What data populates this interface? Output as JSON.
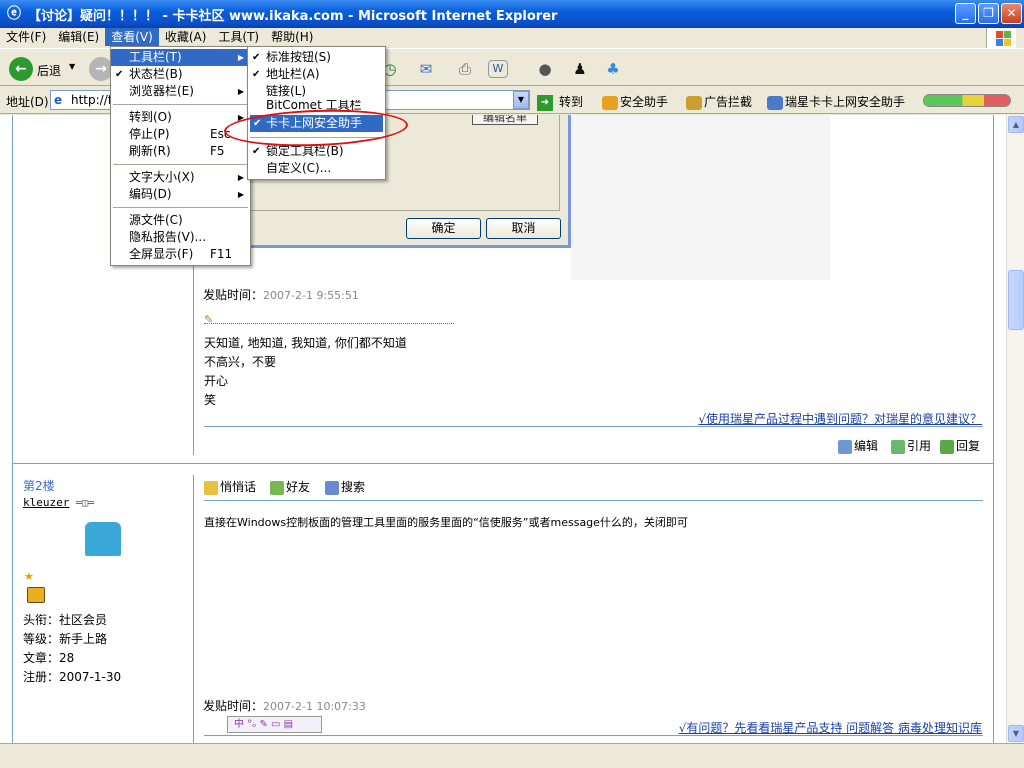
{
  "window": {
    "title": "【讨论】疑问！！！！ - 卡卡社区 www.ikaka.com - Microsoft Internet Explorer",
    "min": "_",
    "max": "❐",
    "close": "✕"
  },
  "menubar": [
    "文件(F)",
    "编辑(E)",
    "查看(V)",
    "收藏(A)",
    "工具(T)",
    "帮助(H)"
  ],
  "toolbar": {
    "back_label": "后退"
  },
  "address": {
    "label": "地址(D)",
    "value": "http://fo",
    "go": "转到",
    "tools": [
      "安全助手",
      "广告拦截",
      "瑞星卡卡上网安全助手"
    ]
  },
  "view_menu": {
    "items": [
      {
        "label": "工具栏(T)",
        "submenu": true,
        "highlight": true
      },
      {
        "label": "状态栏(B)",
        "checked": true
      },
      {
        "label": "浏览器栏(E)",
        "submenu": true
      },
      {
        "sep": true
      },
      {
        "label": "转到(O)",
        "submenu": true
      },
      {
        "label": "停止(P)",
        "shortcut": "Esc"
      },
      {
        "label": "刷新(R)",
        "shortcut": "F5"
      },
      {
        "sep": true
      },
      {
        "label": "文字大小(X)",
        "submenu": true
      },
      {
        "label": "编码(D)",
        "submenu": true
      },
      {
        "sep": true
      },
      {
        "label": "源文件(C)"
      },
      {
        "label": "隐私报告(V)..."
      },
      {
        "label": "全屏显示(F)",
        "shortcut": "F11"
      }
    ]
  },
  "toolbar_menu": {
    "items": [
      {
        "label": "标准按钮(S)",
        "checked": true
      },
      {
        "label": "地址栏(A)",
        "checked": true
      },
      {
        "label": "链接(L)"
      },
      {
        "label": "BitComet 工具栏"
      },
      {
        "label": "卡卡上网安全助手",
        "checked": true,
        "highlight": true
      },
      {
        "label": "锁定工具栏(B)",
        "checked": true
      },
      {
        "label": "自定义(C)..."
      }
    ]
  },
  "dialog": {
    "edit": "编辑名单",
    "ok": "确定",
    "cancel": "取消"
  },
  "post1": {
    "time_label": "发贴时间：",
    "time": "2007-2-1 9:55:51",
    "lines": [
      "天知道, 地知道, 我知道, 你们都不知道",
      "不高兴，不要",
      "开心",
      "笑"
    ],
    "sig_link": "√使用瑞星产品过程中遇到问题？对瑞星的意见建议？",
    "actions": [
      "编辑",
      "引用",
      "回复"
    ]
  },
  "post2": {
    "floor": "第2楼",
    "user": "kleuzer",
    "user_info": [
      "头衔：社区会员",
      "等级：新手上路",
      "文章：28",
      "注册：2007-1-30"
    ],
    "actions": [
      "悄悄话",
      "好友",
      "搜索"
    ],
    "content": "直接在Windows控制板面的管理工具里面的服务里面的“信使服务”或者message什么的，关闭即可",
    "time_label": "发贴时间：",
    "time": "2007-2-1 10:07:33",
    "sig_link": "√有问题？先看看瑞星产品支持 问题解答 病毒处理知识库"
  },
  "colors": {
    "title_blue": "#0a5fdc",
    "menu_highlight": "#316ac5",
    "link": "#1a3fa8",
    "annotation_red": "#e01010"
  }
}
